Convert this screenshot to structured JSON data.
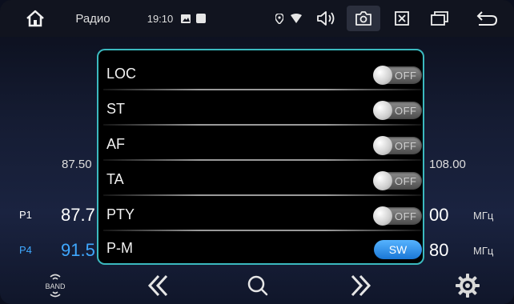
{
  "statusbar": {
    "title": "Радио",
    "time": "19:10"
  },
  "radio": {
    "freq_min": "87.50",
    "freq_max": "108.00",
    "presets": [
      {
        "num": "P1",
        "freq": "87.7",
        "freq_right": "00",
        "unit": "МГц",
        "color": "#ffffff"
      },
      {
        "num": "P4",
        "freq": "91.5",
        "freq_right": "80",
        "unit": "МГц",
        "color": "#3fa8ff"
      }
    ]
  },
  "dialog": {
    "rows": [
      {
        "label": "LOC",
        "control": "toggle",
        "value": "OFF"
      },
      {
        "label": "ST",
        "control": "toggle",
        "value": "OFF"
      },
      {
        "label": "AF",
        "control": "toggle",
        "value": "OFF"
      },
      {
        "label": "TA",
        "control": "toggle",
        "value": "OFF"
      },
      {
        "label": "PTY",
        "control": "toggle",
        "value": "OFF"
      },
      {
        "label": "P-M",
        "control": "button",
        "value": "SW"
      }
    ]
  },
  "bottombar": {
    "band_label": "BAND"
  },
  "colors": {
    "accent": "#3bb9bf",
    "preset_blue": "#3fa8ff",
    "sw_button": "#2e8ff0"
  }
}
